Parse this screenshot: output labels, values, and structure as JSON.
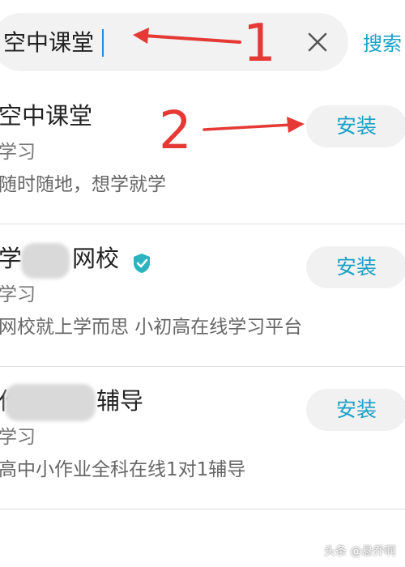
{
  "search": {
    "query": "空中课堂",
    "button_label": "搜索"
  },
  "results": [
    {
      "name": "空中课堂",
      "category": "学习",
      "description": "随时随地，想学就学",
      "install_label": "安装"
    },
    {
      "name_prefix": "学",
      "name_suffix": "网校",
      "category": "学习",
      "description": "网校就上学而思 小初高在线学习平台",
      "install_label": "安装"
    },
    {
      "name_prefix": "作",
      "name_suffix": "辅导",
      "category": "学习",
      "description": "高中小作业全科在线1对1辅导",
      "install_label": "安装"
    }
  ],
  "annotations": {
    "marker_1": "1",
    "marker_2": "2"
  },
  "watermark": "头条 @悬乔啊",
  "colors": {
    "accent": "#1aa0c8",
    "annotation": "#e53935"
  }
}
